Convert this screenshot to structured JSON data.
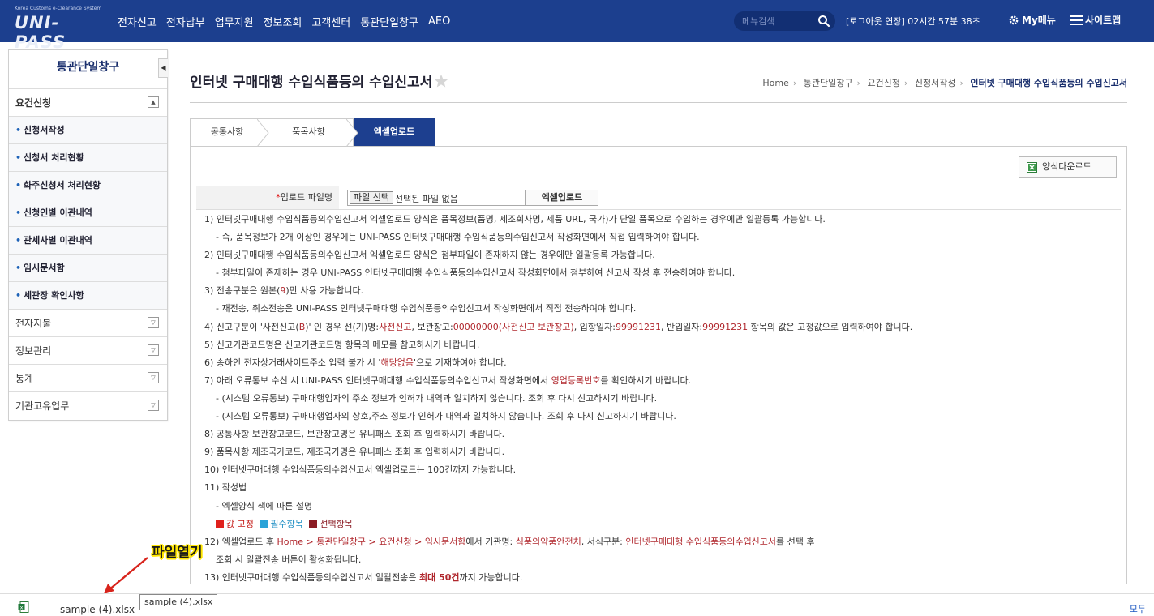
{
  "app": {
    "logo_tagline": "Korea Customs e-Clearance System",
    "logo_text": "UNI-PASS"
  },
  "nav": {
    "items": [
      "전자신고",
      "전자납부",
      "업무지원",
      "정보조회",
      "고객센터",
      "통관단일창구",
      "AEO"
    ],
    "search_placeholder": "메뉴검색",
    "logout_timer": "[로그아웃 연장] 02시간 57분 38초",
    "mymenu_label": "My메뉴",
    "sitemap_label": "사이트맵"
  },
  "sidebar": {
    "title": "통관단일창구",
    "sections": [
      {
        "label": "요건신청",
        "expanded": true
      },
      {
        "label": "전자지불",
        "expanded": false
      },
      {
        "label": "정보관리",
        "expanded": false
      },
      {
        "label": "통계",
        "expanded": false
      },
      {
        "label": "기관고유업무",
        "expanded": false
      }
    ],
    "items": [
      "신청서작성",
      "신청서 처리현황",
      "화주신청서 처리현황",
      "신청인별 이관내역",
      "관세사별 이관내역",
      "임시문서함",
      "세관장 확인사항"
    ]
  },
  "page": {
    "title": "인터넷 구매대행 수입식품등의 수입신고서",
    "breadcrumb": [
      "Home",
      "통관단일창구",
      "요건신청",
      "신청서작성",
      "인터넷 구매대행 수입식품등의 수입신고서"
    ]
  },
  "tabs": [
    "공통사항",
    "품목사항",
    "엑셀업로드"
  ],
  "upload": {
    "download_form_label": "양식다운로드",
    "required_mark": "*",
    "file_label": "업로드 파일명",
    "choose_file_label": "파일 선택",
    "no_file_label": "선택된 파일 없음",
    "excel_upload_label": "엑셀업로드"
  },
  "notes": {
    "n1": "1) 인터넷구매대행 수입식품등의수입신고서 엑셀업로드 양식은 품목정보(품명, 제조회사명, 제품 URL, 국가)가 단일 품목으로 수입하는 경우에만 일괄등록 가능합니다.",
    "n1a": "- 즉, 품목정보가 2개 이상인 경우에는 UNI-PASS 인터넷구매대행 수입식품등의수입신고서 작성화면에서 직접 입력하여야 합니다.",
    "n2": "2) 인터넷구매대행 수입식품등의수입신고서 엑셀업로드 양식은 첨부파일이 존재하지 않는 경우에만 일괄등록 가능합니다.",
    "n2a": "- 첨부파일이 존재하는 경우 UNI-PASS 인터넷구매대행 수입식품등의수입신고서 작성화면에서 첨부하여 신고서 작성 후 전송하여야 합니다.",
    "n3_pre": "3) 전송구분은 원본(",
    "n3_red": "9",
    "n3_post": ")만 사용 가능합니다.",
    "n3a": "- 재전송, 취소전송은 UNI-PASS 인터넷구매대행 수입식품등의수입신고서 작성화면에서 직접 전송하여야 합니다.",
    "n4_a": "4) 신고구분이 '사전신고(",
    "n4_b": "B",
    "n4_c": ")' 인 경우 선(기)명:",
    "n4_d": "사전신고",
    "n4_e": ", 보관창고:",
    "n4_f": "00000000(사전신고 보관창고)",
    "n4_g": ", 입항일자:",
    "n4_h": "99991231",
    "n4_i": ", 반입일자:",
    "n4_j": "99991231",
    "n4_k": " 항목의 값은 고정값으로 입력하여야 합니다.",
    "n5": "5) 신고기관코드명은 신고기관코드명 항목의 메모를 참고하시기 바랍니다.",
    "n6_pre": "6) 송하인 전자상거래사이트주소 입력 불가 시 '",
    "n6_red": "해당없음",
    "n6_post": "'으로 기재하여야 합니다.",
    "n7_pre": "7) 아래 오류통보 수신 시 UNI-PASS 인터넷구매대행 수입식품등의수입신고서 작성화면에서 ",
    "n7_red": "영업등록번호",
    "n7_post": "를 확인하시기 바랍니다.",
    "n7a": "- (시스템 오류통보) 구매대행업자의 주소 정보가 인허가 내역과 일치하지 않습니다. 조회 후 다시 신고하시기 바랍니다.",
    "n7b": "- (시스템 오류통보) 구매대행업자의 상호,주소 정보가 인허가 내역과 일치하지 않습니다. 조회 후 다시 신고하시기 바랍니다.",
    "n8": "8) 공통사항 보관창고코드, 보관창고명은 유니패스 조회 후 입력하시기 바랍니다.",
    "n9": "9) 품목사항 제조국가코드, 제조국가명은 유니패스 조회 후 입력하시기 바랍니다.",
    "n10": "10) 인터넷구매대행 수입식품등의수입신고서 엑셀업로드는 100건까지 가능합니다.",
    "n11": "11) 작성법",
    "n11a": "- 엑셀양식 색에 따른 설명",
    "legend_fixed": "값 고정",
    "legend_required": "필수항목",
    "legend_optional": "선택항목",
    "n12_a": "12) 엑셀업로드 후 ",
    "n12_b": "Home > 통관단일창구 > 요건신청 > 임시문서함",
    "n12_c": "에서 기관명: ",
    "n12_d": "식품의약품안전처",
    "n12_e": ", 서식구분: ",
    "n12_f": "인터넷구매대행 수입식품등의수입신고서",
    "n12_g": "를 선택 후",
    "n12b": "조회 시 일괄전송 버튼이 활성화됩니다.",
    "n13_a": "13) 인터넷구매대행 수입식품등의수입신고서 일괄전송은 ",
    "n13_b": "최대 50건",
    "n13_c": "까지 가능합니다."
  },
  "colors": {
    "nav_bg": "#1c3f8e",
    "active_tab": "#1d3f8f",
    "fixed": "#e0201c",
    "required": "#2aa3d8",
    "optional": "#8b1c24",
    "note_red": "#b0272d"
  },
  "annotation": {
    "label": "파일열기"
  },
  "download_bar": {
    "file_name": "sample (4).xlsx",
    "tooltip": "sample (4).xlsx",
    "show_all": "모두"
  }
}
